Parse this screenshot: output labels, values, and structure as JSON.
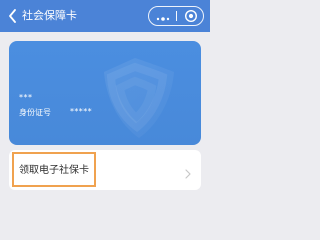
{
  "nav": {
    "title": "社会保障卡",
    "back_icon": "back-arrow-icon",
    "more_icon": "more-dots-icon",
    "close_icon": "target-close-icon",
    "bar_color": "#4b83d7"
  },
  "card": {
    "name_mask": "***",
    "id_label": "身份证号",
    "id_value_mask": "*****",
    "card_color": "#4a8ce0"
  },
  "action": {
    "label": "领取电子社保卡",
    "arrow_icon": "chevron-right-icon",
    "highlight_color": "#f0a24f"
  }
}
